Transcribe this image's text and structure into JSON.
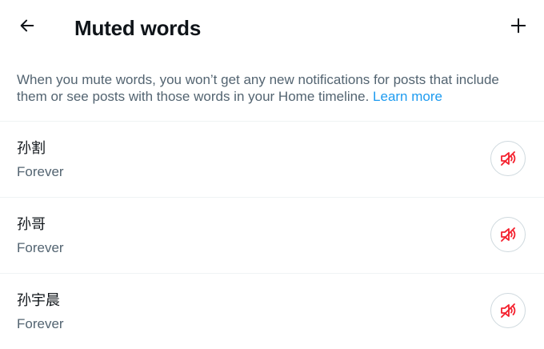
{
  "header": {
    "title": "Muted words",
    "back_icon": "arrow-left-icon",
    "add_icon": "plus-icon"
  },
  "description": {
    "text": "When you mute words, you won’t get any new notifications for posts that include them or see posts with those words in your Home timeline. ",
    "link_label": "Learn more"
  },
  "muted_words": [
    {
      "word": "孙割",
      "duration": "Forever",
      "action_icon": "speaker-muted-icon"
    },
    {
      "word": "孙哥",
      "duration": "Forever",
      "action_icon": "speaker-muted-icon"
    },
    {
      "word": "孙宇晨",
      "duration": "Forever",
      "action_icon": "speaker-muted-icon"
    }
  ],
  "colors": {
    "text_primary": "#0f1419",
    "text_secondary": "#536471",
    "link": "#1d9bf0",
    "mute_icon": "#f4212e",
    "divider": "#eff3f4"
  }
}
